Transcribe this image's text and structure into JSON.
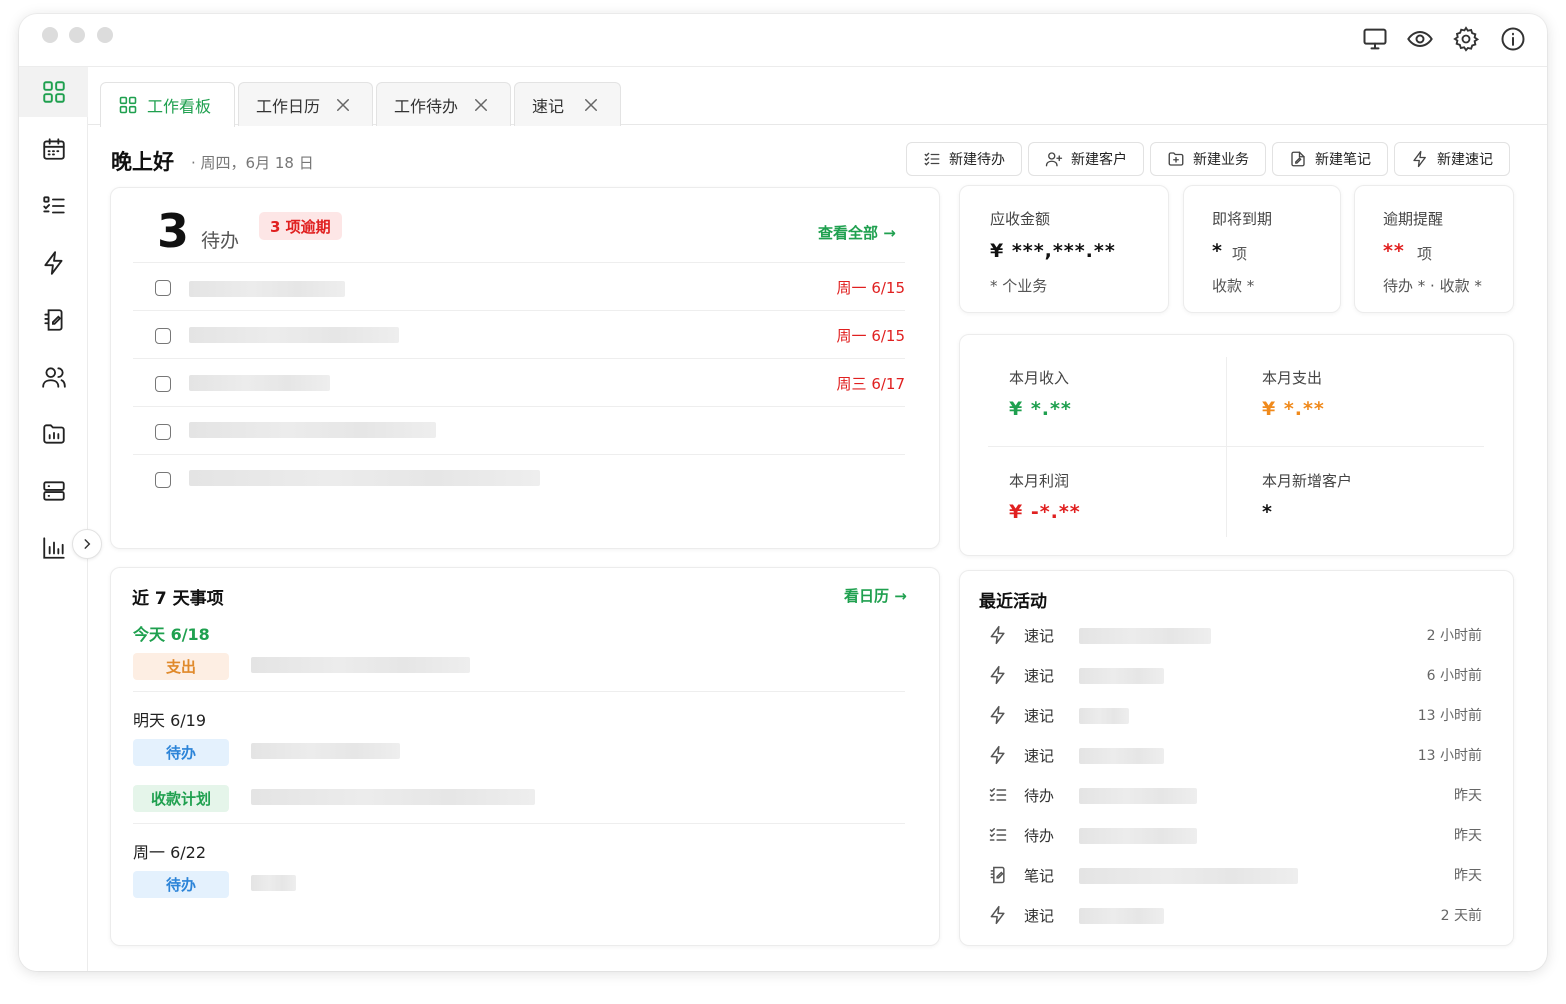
{
  "tabs": [
    {
      "label": "工作看板",
      "icon": "dashboard-icon",
      "active": true
    },
    {
      "label": "工作日历",
      "icon": "",
      "active": false
    },
    {
      "label": "工作待办",
      "icon": "",
      "active": false
    },
    {
      "label": "速记",
      "icon": "",
      "active": false
    }
  ],
  "header": {
    "greeting": "晚上好",
    "date": "· 周四，6月 18 日"
  },
  "quick_actions": [
    {
      "label": "新建待办",
      "icon": "checklist-icon"
    },
    {
      "label": "新建客户",
      "icon": "user-plus-icon"
    },
    {
      "label": "新建业务",
      "icon": "folder-plus-icon"
    },
    {
      "label": "新建笔记",
      "icon": "note-icon"
    },
    {
      "label": "新建速记",
      "icon": "bolt-icon"
    }
  ],
  "todo_card": {
    "count": "3",
    "count_label": "待办",
    "overdue_badge": "3 项逾期",
    "view_all": "查看全部 →",
    "items": [
      {
        "due": "周一 6/15"
      },
      {
        "due": "周一 6/15"
      },
      {
        "due": "周三 6/17"
      },
      {
        "due": ""
      },
      {
        "due": ""
      }
    ]
  },
  "summary": {
    "receivable": {
      "label": "应收金额",
      "value": "¥ ***,***.**",
      "sub": "* 个业务"
    },
    "expiring": {
      "label": "即将到期",
      "value": "*",
      "unit": "项",
      "sub": "收款 *"
    },
    "overdue": {
      "label": "逾期提醒",
      "value": "**",
      "unit": "项",
      "sub": "待办 * · 收款 *"
    }
  },
  "monthly": {
    "income": {
      "label": "本月收入",
      "value": "¥ *.**",
      "color": "#1fa04f"
    },
    "expense": {
      "label": "本月支出",
      "value": "¥ *.**",
      "color": "#f08a1c"
    },
    "profit": {
      "label": "本月利润",
      "value": "¥ -*.**",
      "color": "#e02020"
    },
    "new_customers": {
      "label": "本月新增客户",
      "value": "*",
      "color": "#111111"
    }
  },
  "week": {
    "title": "近 7 天事项",
    "link": "看日历 →",
    "days": [
      {
        "label": "今天 6/18",
        "events": [
          {
            "tag": "支出",
            "style": "orange"
          }
        ]
      },
      {
        "label": "明天 6/19",
        "events": [
          {
            "tag": "待办",
            "style": "blue"
          },
          {
            "tag": "收款计划",
            "style": "green"
          }
        ]
      },
      {
        "label": "周一 6/22",
        "events": [
          {
            "tag": "待办",
            "style": "blue"
          }
        ]
      }
    ]
  },
  "activity": {
    "title": "最近活动",
    "items": [
      {
        "type": "速记",
        "icon": "bolt-icon",
        "time": "2 小时前"
      },
      {
        "type": "速记",
        "icon": "bolt-icon",
        "time": "6 小时前"
      },
      {
        "type": "速记",
        "icon": "bolt-icon",
        "time": "13 小时前"
      },
      {
        "type": "速记",
        "icon": "bolt-icon",
        "time": "13 小时前"
      },
      {
        "type": "待办",
        "icon": "checklist-icon",
        "time": "昨天"
      },
      {
        "type": "待办",
        "icon": "checklist-icon",
        "time": "昨天"
      },
      {
        "type": "笔记",
        "icon": "note-icon",
        "time": "昨天"
      },
      {
        "type": "速记",
        "icon": "bolt-icon",
        "time": "2 天前"
      }
    ]
  },
  "colors": {
    "accent": "#1fa04f",
    "danger": "#e02020",
    "warning": "#f08a1c",
    "info": "#2c84d8"
  }
}
